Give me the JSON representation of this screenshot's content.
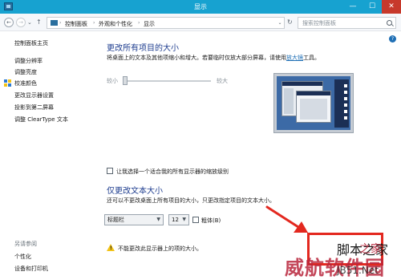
{
  "window": {
    "title": "显示",
    "minimize_glyph": "—",
    "maximize_glyph": "☐",
    "close_glyph": "✕"
  },
  "address_bar": {
    "back_glyph": "←",
    "forward_glyph": "→",
    "recent_glyph": "⌄",
    "up_glyph": "↑",
    "breadcrumbs": [
      "控制面板",
      "外观和个性化",
      "显示"
    ],
    "separator": "›",
    "dropdown_glyph": "⌄",
    "refresh_glyph": "↻",
    "search_placeholder": "搜索控制面板"
  },
  "help_glyph": "?",
  "left_pane": {
    "home_link": "控制面板主页",
    "tasks": [
      "调整分辨率",
      "调整亮度",
      "校准颜色",
      "更改显示器设置",
      "投影到第二屏幕",
      "调整 ClearType 文本"
    ],
    "see_also_heading": "另请参阅",
    "see_also_links": [
      "个性化",
      "设备和打印机"
    ]
  },
  "main": {
    "size_heading": "更改所有项目的大小",
    "size_desc_prefix": "将桌面上的文本及其他项缩小和增大。若要临时仅放大部分屏幕，请使用",
    "magnifier_link": "放大镜",
    "size_desc_suffix": "工具。",
    "slider_small_label": "较小",
    "slider_large_label": "较大",
    "slider_level": 0,
    "per_display_checkbox_label": "让我选择一个适合我的所有显示器的缩放级别",
    "per_display_checked": false,
    "text_heading": "仅更改文本大小",
    "text_desc": "还可以不更改桌面上所有项目的大小，只更改指定项目的文本大小。",
    "element_select_value": "标题栏",
    "font_size_select_value": "12",
    "bold_checkbox_label": "粗体(B)",
    "bold_checked": false,
    "warning_text": "不能更改此显示器上的项的大小。"
  },
  "annotation": {
    "boxed_text": "脚本之家",
    "color": "#e3281f"
  },
  "watermark": {
    "main_text": "威航软件园",
    "top_text": "之家",
    "url_text": "JB51.Net",
    "color": "#b8263c"
  },
  "colors": {
    "title_bar": "#17a2d0",
    "heading": "#1e3d8f",
    "link": "#1f6fb5",
    "close_button": "#c7392b"
  }
}
